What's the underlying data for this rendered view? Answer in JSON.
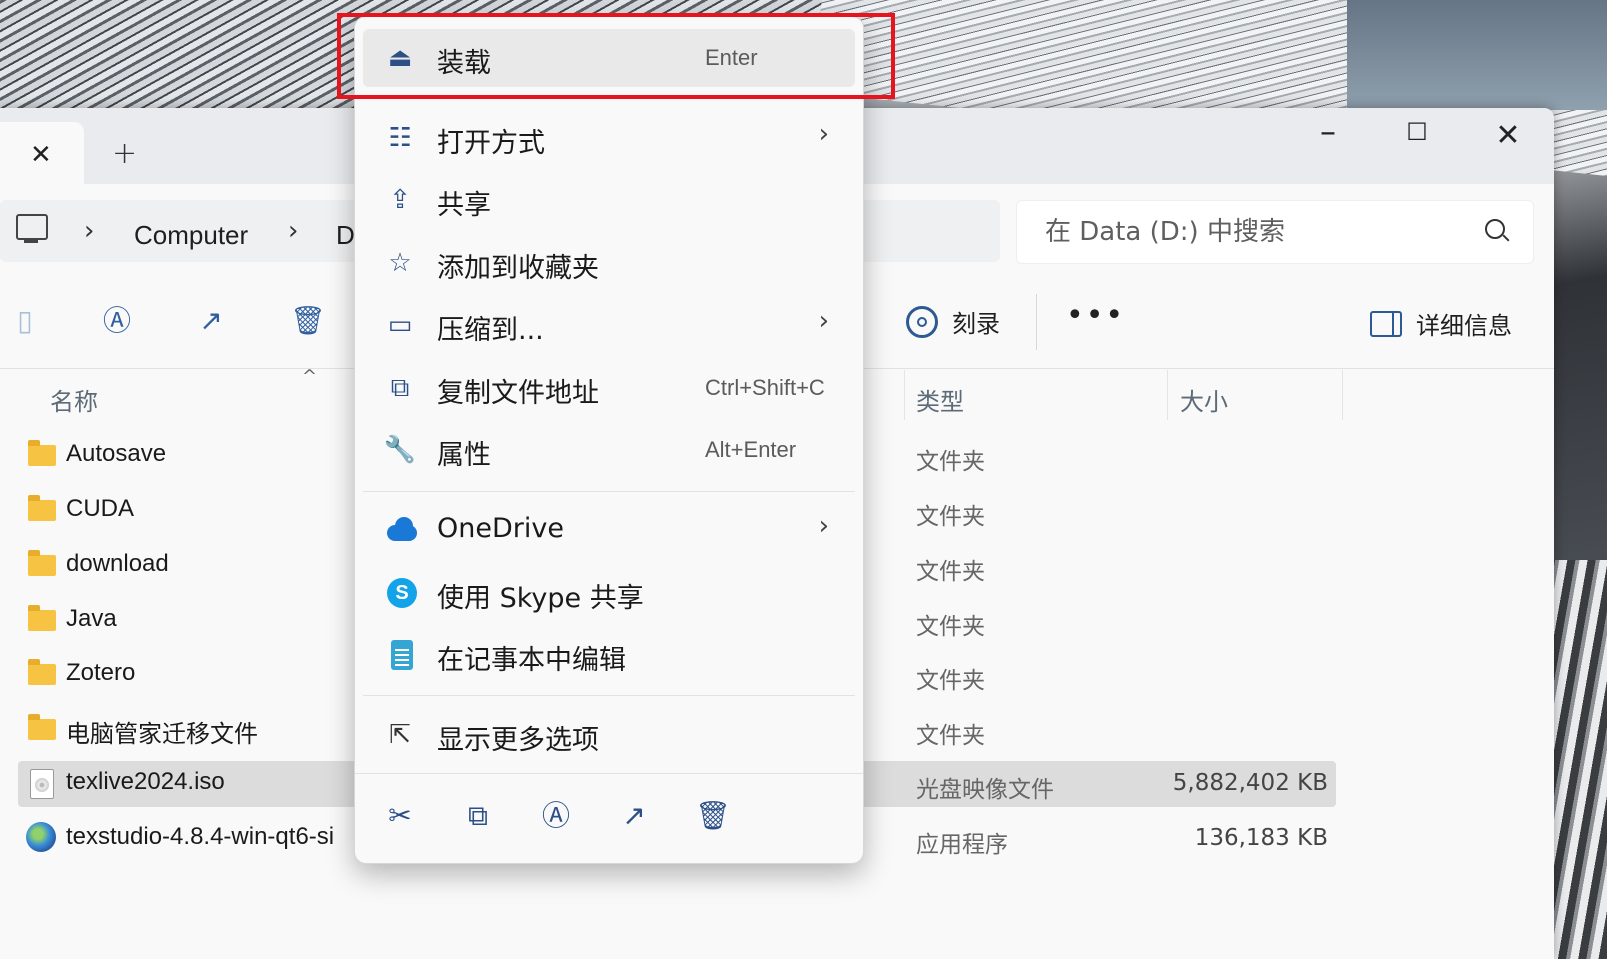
{
  "window": {
    "address": {
      "crumb_root": "Computer",
      "crumb_partial": "D",
      "search_placeholder": "在 Data (D:) 中搜索"
    },
    "toolbar": {
      "burn_label": "刻录",
      "more_label": "•••",
      "details_label": "详细信息"
    },
    "columns": {
      "name": "名称",
      "type": "类型",
      "size": "大小"
    },
    "files": [
      {
        "name": "Autosave",
        "type": "文件夹",
        "size": "",
        "icon": "folder-icon"
      },
      {
        "name": "CUDA",
        "type": "文件夹",
        "size": "",
        "icon": "folder-icon"
      },
      {
        "name": "download",
        "type": "文件夹",
        "size": "",
        "icon": "folder-icon"
      },
      {
        "name": "Java",
        "type": "文件夹",
        "size": "",
        "icon": "folder-icon"
      },
      {
        "name": "Zotero",
        "type": "文件夹",
        "size": "",
        "icon": "folder-icon"
      },
      {
        "name": "电脑管家迁移文件",
        "type": "文件夹",
        "size": "",
        "icon": "folder-icon"
      },
      {
        "name": "texlive2024.iso",
        "type": "光盘映像文件",
        "size": "5,882,402 KB",
        "icon": "disc-image-icon",
        "selected": true
      },
      {
        "name": "texstudio-4.8.4-win-qt6-si",
        "type": "应用程序",
        "size": "136,183 KB",
        "icon": "app-icon"
      }
    ]
  },
  "context_menu": {
    "items": [
      {
        "label": "装载",
        "shortcut": "Enter",
        "icon": "mount-icon",
        "highlighted": true
      },
      {
        "label": "打开方式",
        "shortcut": "",
        "icon": "open-with-icon",
        "submenu": true
      },
      {
        "label": "共享",
        "shortcut": "",
        "icon": "share-icon"
      },
      {
        "label": "添加到收藏夹",
        "shortcut": "",
        "icon": "star-icon"
      },
      {
        "label": "压缩到...",
        "shortcut": "",
        "icon": "compress-icon",
        "submenu": true
      },
      {
        "label": "复制文件地址",
        "shortcut": "Ctrl+Shift+C",
        "icon": "copy-path-icon"
      },
      {
        "label": "属性",
        "shortcut": "Alt+Enter",
        "icon": "wrench-icon"
      },
      {
        "label": "OneDrive",
        "shortcut": "",
        "icon": "onedrive-icon",
        "submenu": true
      },
      {
        "label": "使用 Skype 共享",
        "shortcut": "",
        "icon": "skype-icon"
      },
      {
        "label": "在记事本中编辑",
        "shortcut": "",
        "icon": "notepad-icon"
      },
      {
        "label": "显示更多选项",
        "shortcut": "",
        "icon": "show-more-icon"
      }
    ],
    "bottom_actions": [
      "cut-icon",
      "copy-icon",
      "rename-icon",
      "share-icon",
      "delete-icon"
    ]
  },
  "colors": {
    "highlight_box": "#e8141d",
    "accent": "#2b4f86",
    "selected_row": "#dcdcdc"
  }
}
